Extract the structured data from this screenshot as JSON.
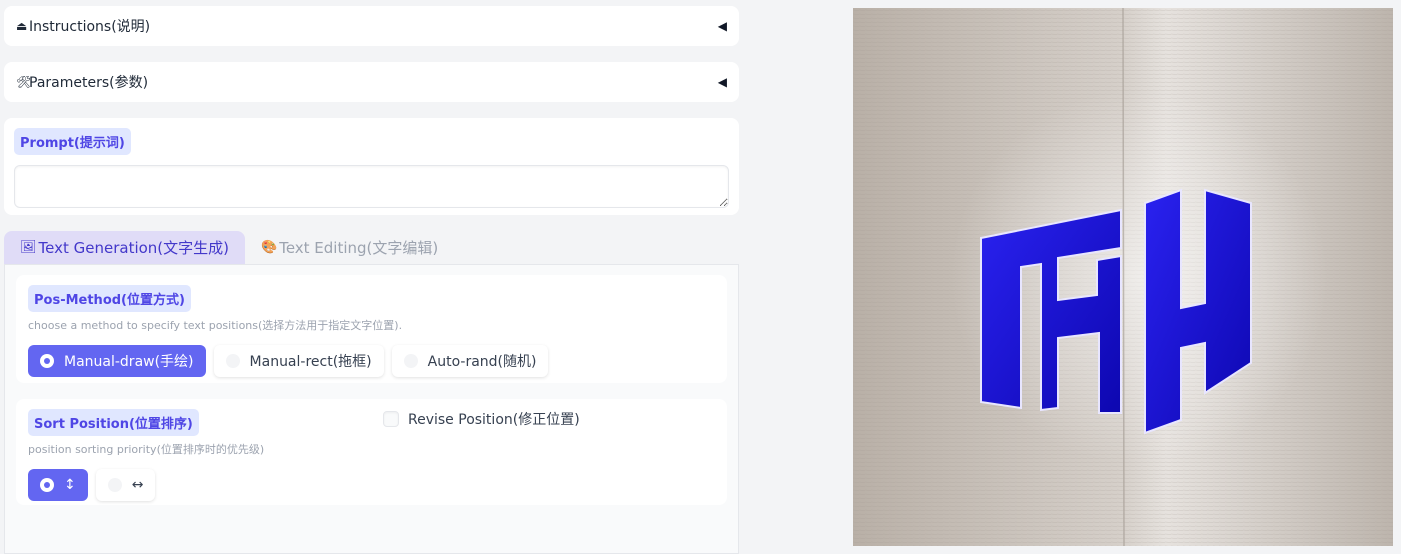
{
  "accordions": [
    {
      "icon": "⏏",
      "label": "Instructions(说明)",
      "arrow": "◀"
    },
    {
      "icon": "🛠",
      "label": "Parameters(参数)",
      "arrow": "◀"
    }
  ],
  "prompt": {
    "label": "Prompt(提示词)",
    "value": ""
  },
  "tabs": [
    {
      "icon": "🖼",
      "label": "Text Generation(文字生成)",
      "active": true
    },
    {
      "icon": "🎨",
      "label": "Text Editing(文字编辑)",
      "active": false
    }
  ],
  "pos_method": {
    "label": "Pos-Method(位置方式)",
    "info": "choose a method to specify text positions(选择方法用于指定文字位置).",
    "options": [
      "Manual-draw(手绘)",
      "Manual-rect(拖框)",
      "Auto-rand(随机)"
    ],
    "selected": "Manual-draw(手绘)"
  },
  "sort_position": {
    "label": "Sort Position(位置排序)",
    "info": "position sorting priority(位置排序时的优先级)",
    "options": [
      "↕",
      "↔"
    ],
    "selected": "↕"
  },
  "revise_position": {
    "label": "Revise Position(修正位置)",
    "checked": false
  },
  "colors": {
    "accent": "#6366f1",
    "chip_bg": "#e0e7ff",
    "logo_blue": "#1a10d8"
  }
}
